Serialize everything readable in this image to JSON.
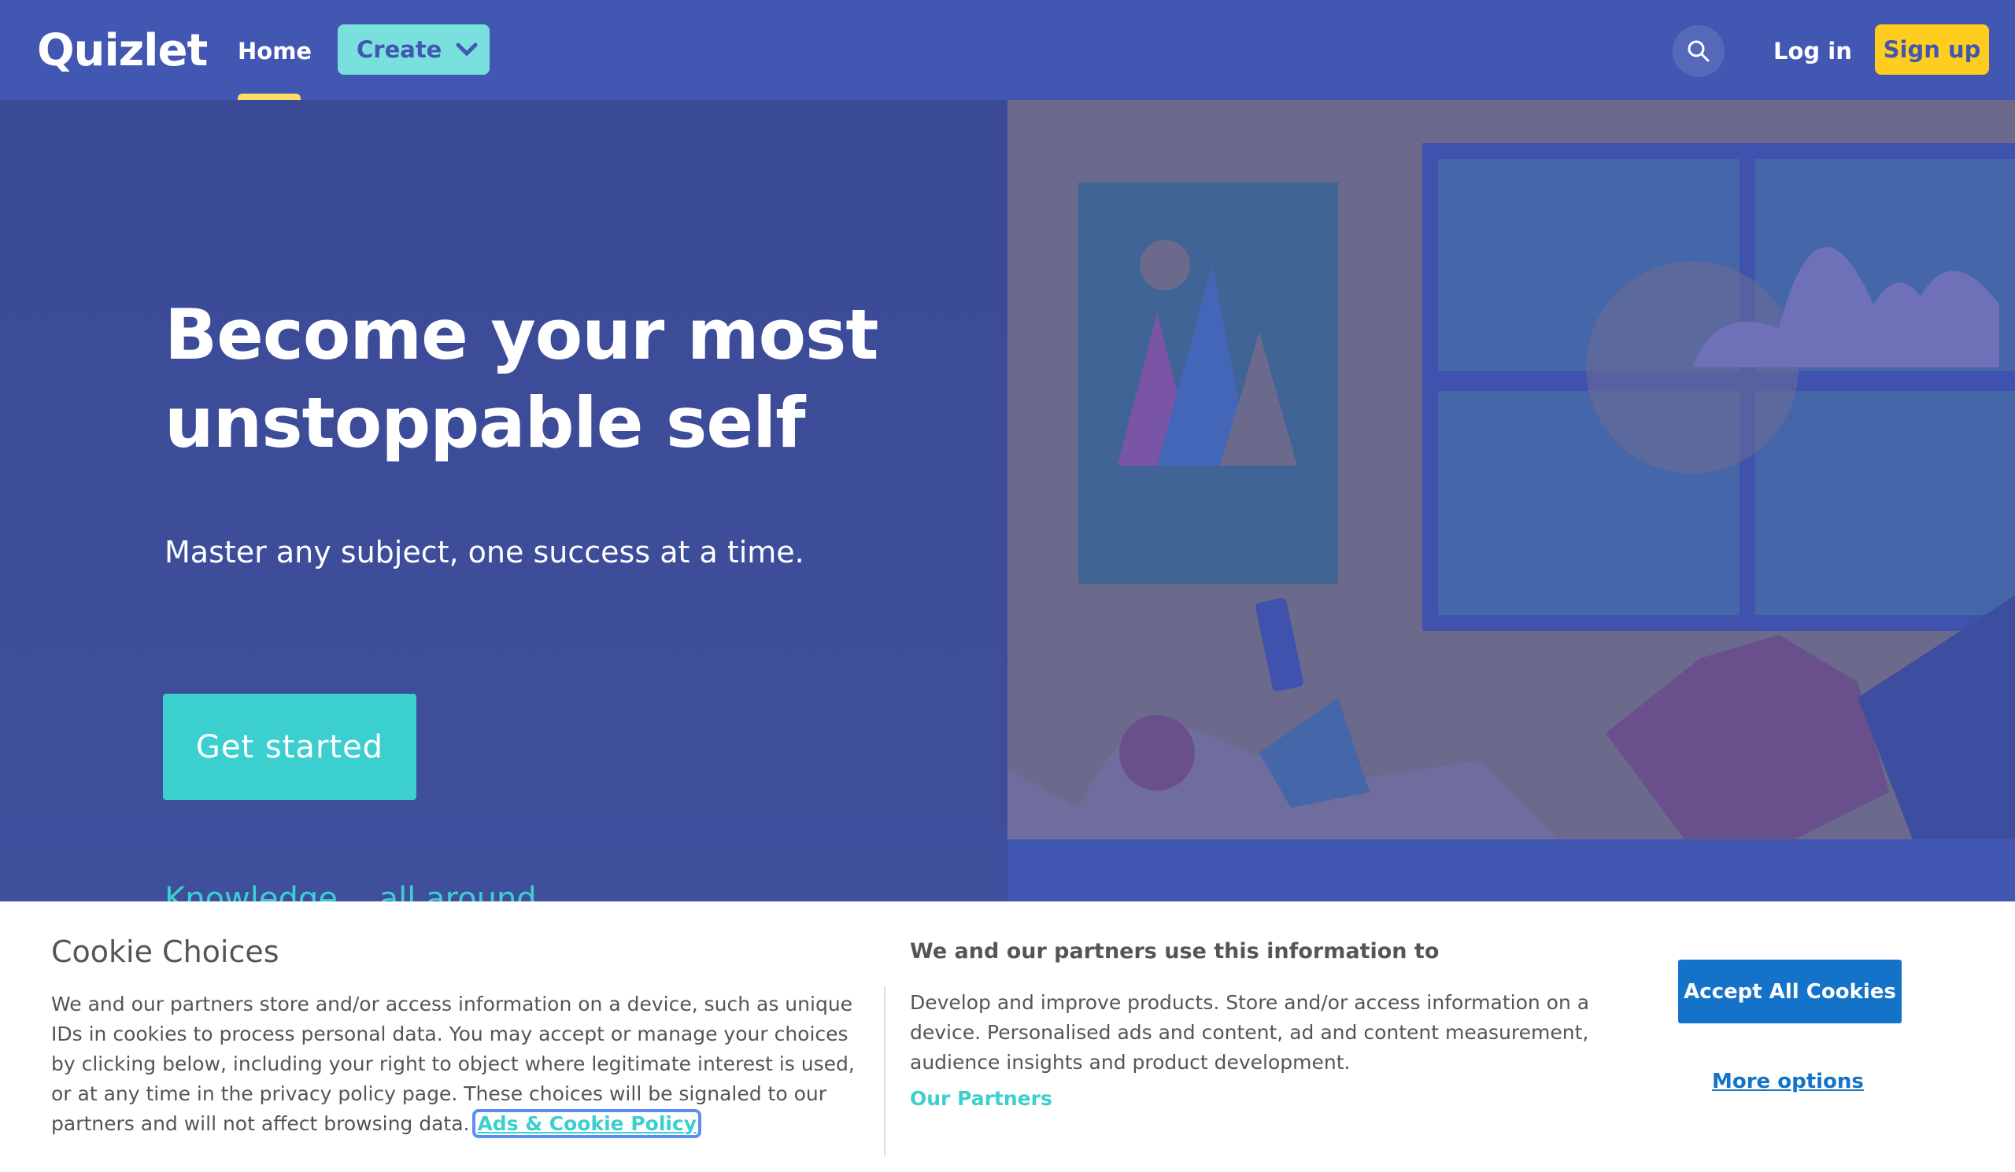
{
  "header": {
    "logo": "Quizlet",
    "home": "Home",
    "create": "Create",
    "login": "Log in",
    "signup": "Sign up"
  },
  "hero": {
    "headline_1": "Become your most",
    "headline_2": "unstoppable self",
    "subtitle": "Master any subject, one success at a time.",
    "cta": "Get started",
    "peek": "Knowledge… all around"
  },
  "cookie": {
    "title": "Cookie Choices",
    "body": "We and our partners store and/or access information on a device, such as unique IDs in cookies to process personal data. You may accept or manage your choices by clicking below, including your right to object where legitimate interest is used, or at any time in the privacy policy page. These choices will be signaled to our partners and will not affect browsing data.",
    "policy_link": "Ads & Cookie Policy",
    "purposes_title": "We and our partners use this information to",
    "purposes_body": "Develop and improve products. Store and/or access information on a device. Personalised ads and content, ad and content measurement, audience insights and product development.",
    "partners_link": "Our Partners",
    "accept": "Accept All Cookies",
    "more": "More options"
  },
  "colors": {
    "brand": "#4257b2",
    "accent": "#3ccfcf",
    "signup": "#ffcd1f",
    "accept": "#1473c8"
  }
}
